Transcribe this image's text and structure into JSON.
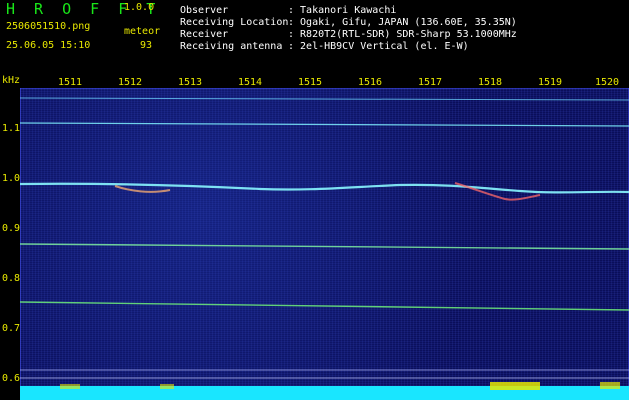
{
  "header": {
    "app_title": "H R O F F T",
    "version": "1.0.0",
    "filename": "2506051510.png",
    "mode": "meteor",
    "datetime": "25.06.05 15:10",
    "count": "93",
    "observer_label": "Observer",
    "observer_value": ": Takanori Kawachi",
    "location_label": "Receiving Location",
    "location_value": ": Ogaki, Gifu, JAPAN (136.60E, 35.35N)",
    "receiver_label": "Receiver",
    "receiver_value": ": R820T2(RTL-SDR) SDR-Sharp 53.1000MHz",
    "antenna_label": "Receiving antenna",
    "antenna_value": ": 2el-HB9CV Vertical (el. E-W)"
  },
  "axes": {
    "y_unit": "kHz",
    "x_ticks": [
      "1511",
      "1512",
      "1513",
      "1514",
      "1515",
      "1516",
      "1517",
      "1518",
      "1519",
      "1520"
    ],
    "y_ticks": [
      "1.1",
      "1.0",
      "0.9",
      "0.8",
      "0.7",
      "0.6"
    ]
  },
  "colors": {
    "header_text": "#e8e800",
    "title": "#19e619",
    "plot_bg": "#0a0e5a",
    "trace": "#7ff0ff",
    "noise_floor": "#19e6ff"
  }
}
